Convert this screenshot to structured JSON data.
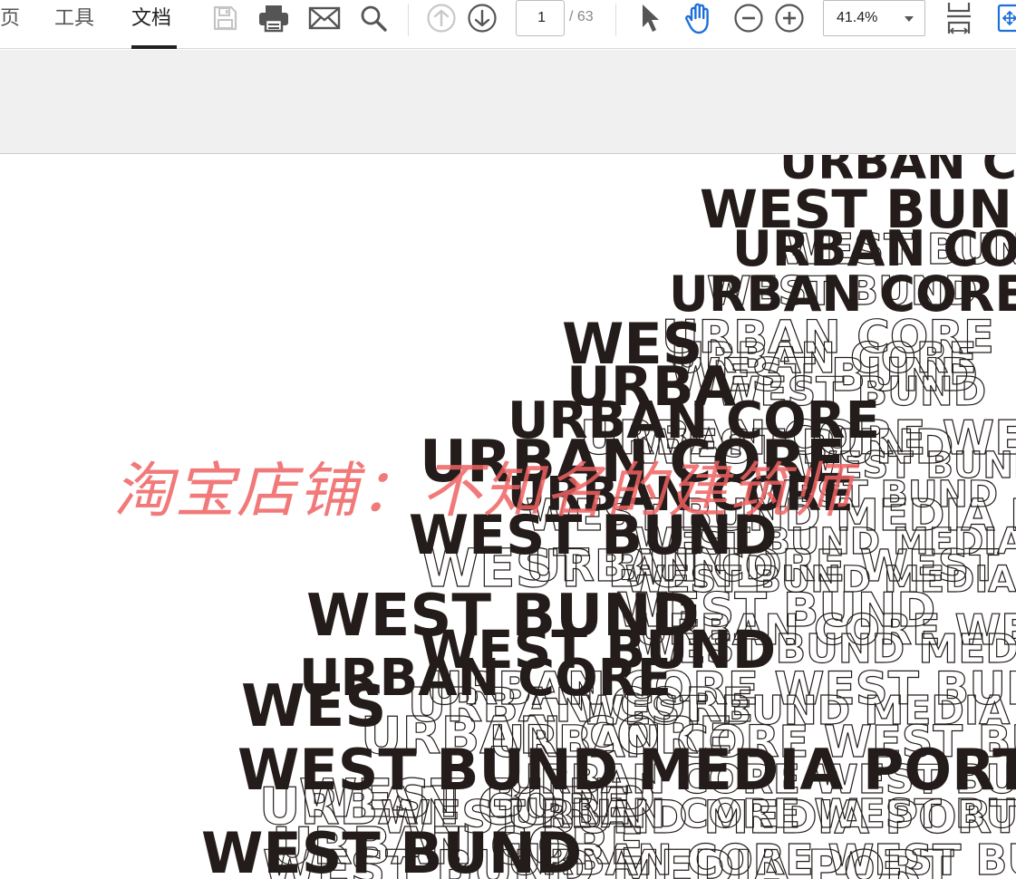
{
  "toolbar": {
    "tabs": [
      {
        "label": "页",
        "active": false
      },
      {
        "label": "工具",
        "active": false
      },
      {
        "label": "文档",
        "active": true
      }
    ],
    "icons": [
      "save-icon",
      "print-icon",
      "mail-icon",
      "search-icon",
      "arrow-up-icon",
      "arrow-down-icon",
      "pointer-icon",
      "hand-icon",
      "zoom-out-icon",
      "zoom-in-icon",
      "fit-page-icon",
      "fit-width-icon"
    ],
    "page_current": "1",
    "page_total": "/ 63",
    "zoom_value": "41.4%"
  },
  "document": {
    "phrases": [
      "URBAN CORE",
      "WEST BUND",
      "WEST BUND MEDIA PORT",
      "URBAN CORE WEST BUND",
      "URBAN C",
      "WES",
      "URBA"
    ]
  },
  "watermark": "淘宝店铺：不知名的建筑师",
  "colors": {
    "accent_blue": "#1e6fd9",
    "text_black": "#231c1a",
    "watermark": "#f06262",
    "band_grey": "#f0f0f0"
  }
}
